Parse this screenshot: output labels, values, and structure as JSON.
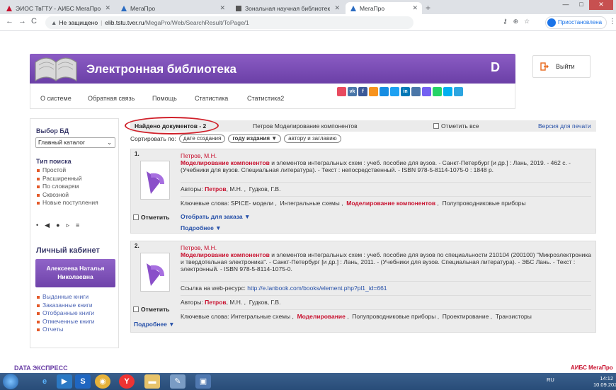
{
  "browser": {
    "tabs": [
      {
        "title": "ЭИОС ТвГТУ - АИБС МегаПро",
        "active": false
      },
      {
        "title": "МегаПро",
        "active": false
      },
      {
        "title": "Зональная научная библиотек",
        "active": false
      },
      {
        "title": "МегаПро",
        "active": true
      }
    ],
    "new_tab": "+",
    "back": "←",
    "forward": "→",
    "reload": "C",
    "security": "Не защищено",
    "host": "elib.tstu.tver.ru",
    "path": "/MegaPro/Web/SearchResult/ToPage/1",
    "profile_label": "Приостановлена",
    "menu": "⋮",
    "win_min": "—",
    "win_max": "□",
    "win_close": "✕"
  },
  "header": {
    "title": "Электронная библиотека",
    "logout": "Выйти"
  },
  "topnav": [
    "О системе",
    "Обратная связь",
    "Помощь",
    "Статистика",
    "Статистика2"
  ],
  "social": [
    {
      "color": "#e84a5f",
      "glyph": ""
    },
    {
      "color": "#4a76a8",
      "glyph": "vk"
    },
    {
      "color": "#3b5998",
      "glyph": "f"
    },
    {
      "color": "#f7931e",
      "glyph": ""
    },
    {
      "color": "#168de2",
      "glyph": ""
    },
    {
      "color": "#1da1f2",
      "glyph": ""
    },
    {
      "color": "#0077b5",
      "glyph": "in"
    },
    {
      "color": "#4a76a8",
      "glyph": ""
    },
    {
      "color": "#7360f2",
      "glyph": ""
    },
    {
      "color": "#25d366",
      "glyph": ""
    },
    {
      "color": "#00aff0",
      "glyph": ""
    },
    {
      "color": "#2ca5e0",
      "glyph": ""
    }
  ],
  "sidebar": {
    "db_heading": "Выбор БД",
    "db_selected": "Главный каталог",
    "search_heading": "Тип поиска",
    "search_types": [
      "Простой",
      "Расширенный",
      "По словарям",
      "Сквозной",
      "Новые поступления"
    ],
    "cabinet_heading": "Личный кабинет",
    "user_name": "Алексеева Наталья Николаевна",
    "cabinet_items": [
      "Выданные книги",
      "Заказанные книги",
      "Отобранные книги",
      "Отмеченные книги",
      "Отчеты"
    ]
  },
  "results": {
    "found": "Найдено документов - 2",
    "query": "Петров Моделирование компонентов",
    "mark_all": "Отметить все",
    "print": "Версия для печати",
    "sort_label": "Сортировать по:",
    "sort_options": [
      {
        "label": "дате создания",
        "active": false
      },
      {
        "label": "году издания ▼",
        "active": true
      },
      {
        "label": "автору и заглавию",
        "active": false
      }
    ],
    "mark": "Отметить",
    "more": "Подробнее ▼",
    "items": [
      {
        "num": "1.",
        "author": "Петров, М.Н.",
        "title_hl": "Моделирование компонентов",
        "desc": " и элементов интегральных схем : учеб. пособие для вузов. - Санкт-Петербург [и др.] : Лань, 2019. - 462 с. - (Учебники для вузов. Специальная литература). - Текст : непосредственный. - ISBN 978-5-8114-1075-0 : 1848 р.",
        "authors_label": "Авторы:",
        "author1": "Петров",
        "author1_rest": ", М.Н.",
        "author2": "Гудков, Г.В.",
        "keywords_label": "Ключевые слова:",
        "kw1": "SPICE- модели",
        "kw2": "Интегральные схемы",
        "kw3": "Моделирование компонентов",
        "kw4": "Полупроводниковые приборы",
        "order": "Отобрать для заказа ▼"
      },
      {
        "num": "2.",
        "author": "Петров, М.Н.",
        "title_hl": "Моделирование компонентов",
        "desc": " и элементов интегральных схем : учеб. пособие для вузов по специальности 210104 (200100) \"Микроэлектроника и твердотельная электроника\". - Санкт-Петербург [и др.] : Лань, 2011. - (Учебники для вузов. Специальная литература). - ЭБС Лань. - Текст : электронный. - ISBN 978-5-8114-1075-0.",
        "link_label": "Ссылка на web-ресурс:",
        "link": "http://e.lanbook.com/books/element.php?pl1_id=661",
        "authors_label": "Авторы:",
        "author1": "Петров",
        "author1_rest": ", М.Н.",
        "author2": "Гудков, Г.В.",
        "keywords_label": "Ключевые слова:",
        "kw1": "Интегральные схемы",
        "kw2": "Моделирование",
        "kw3": "Полупроводниковые приборы",
        "kw4": "Проектирование",
        "kw5": "Транзисторы"
      }
    ]
  },
  "footer": {
    "left": "DATA ЭКСПРЕСС",
    "right": "АИБС МегаПро"
  },
  "taskbar": {
    "lang": "RU",
    "time": "14:12",
    "date": "10.09.2020"
  },
  "colors": {
    "accent": "#7a4bb8",
    "link": "#2650a8",
    "highlight": "#c8102e",
    "annotation": "#d0202a"
  }
}
